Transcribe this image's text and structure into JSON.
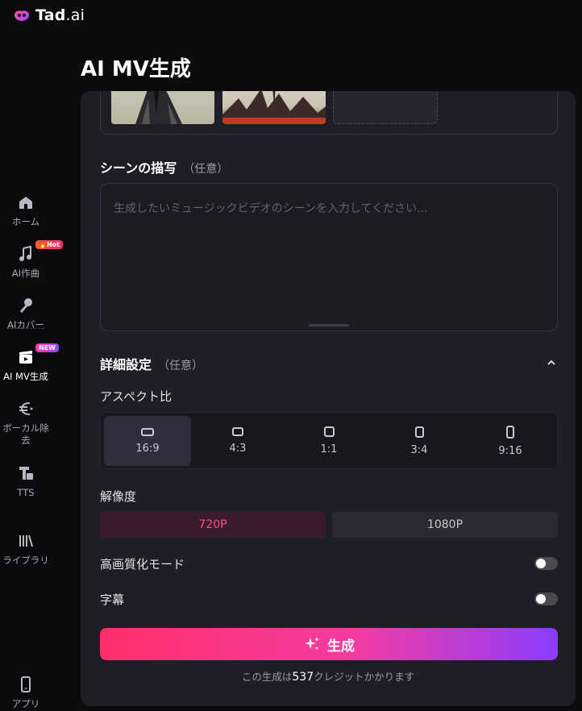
{
  "brand": {
    "name": "Tad",
    "suffix": ".ai"
  },
  "sidebar": {
    "items": [
      {
        "label": "ホーム",
        "icon": "home-icon"
      },
      {
        "label": "AI作曲",
        "icon": "music-note-icon",
        "badge": "🔥Hot"
      },
      {
        "label": "AIカバー",
        "icon": "microphone-icon"
      },
      {
        "label": "AI MV生成",
        "icon": "clapperboard-icon",
        "badge": "NEW",
        "active": true
      },
      {
        "label": "ボーカル除去",
        "icon": "vocal-remove-icon"
      },
      {
        "label": "TTS",
        "icon": "tts-icon"
      },
      {
        "label": "ライブラリ",
        "icon": "library-icon"
      }
    ],
    "app_label": "アプリ"
  },
  "page": {
    "title": "AI MV生成"
  },
  "scene": {
    "title": "シーンの描写",
    "optional": "（任意）",
    "placeholder": "生成したいミュージックビデオのシーンを入力してください..."
  },
  "advanced": {
    "title": "詳細設定",
    "optional": "（任意）",
    "aspect_label": "アスペクト比",
    "aspect_options": [
      "16:9",
      "4:3",
      "1:1",
      "3:4",
      "9:16"
    ],
    "aspect_selected": "16:9",
    "resolution_label": "解像度",
    "resolutions": [
      "720P",
      "1080P"
    ],
    "resolution_selected": "720P",
    "hq_mode_label": "高画質化モード",
    "hq_mode_on": false,
    "subtitle_label": "字幕",
    "subtitle_on": false
  },
  "generate": {
    "label": "生成",
    "credit_prefix": "この生成は",
    "credit_amount": "537",
    "credit_suffix": "クレジットかかります"
  },
  "colors": {
    "accent_pink": "#ff4f8b",
    "gradient_start": "#ff2f6a",
    "gradient_end": "#8a3dff",
    "panel_bg": "#1e1e26"
  }
}
